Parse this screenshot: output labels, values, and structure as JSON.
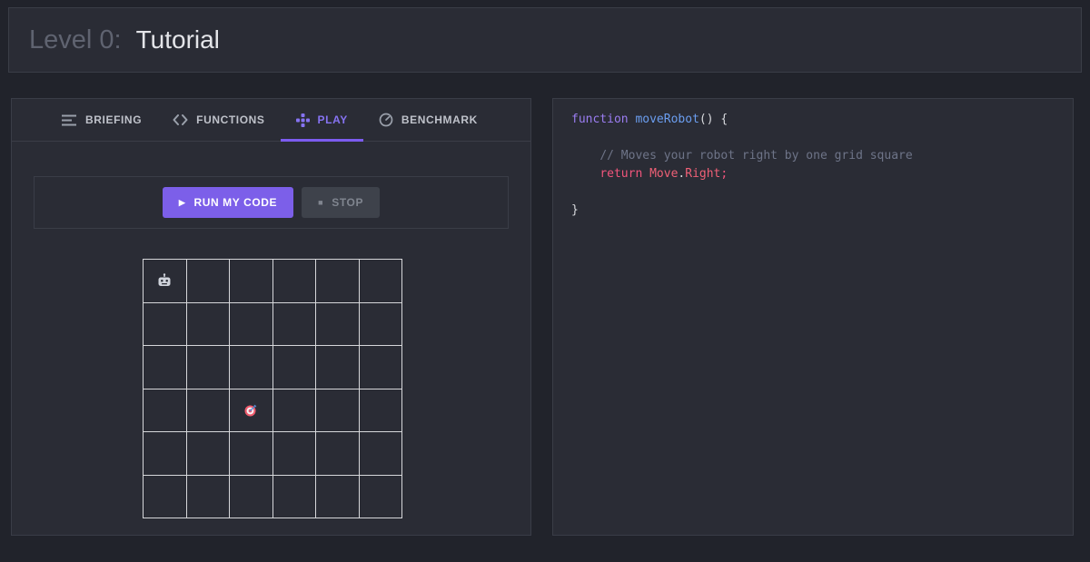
{
  "header": {
    "level_label": "Level 0:",
    "level_title": "Tutorial"
  },
  "tabs": [
    {
      "label": "BRIEFING",
      "icon": "briefing-icon",
      "active": false
    },
    {
      "label": "FUNCTIONS",
      "icon": "functions-icon",
      "active": false
    },
    {
      "label": "PLAY",
      "icon": "play-tab-icon",
      "active": true
    },
    {
      "label": "BENCHMARK",
      "icon": "benchmark-icon",
      "active": false
    }
  ],
  "controls": {
    "run_label": "RUN MY CODE",
    "stop_label": "STOP",
    "run_icon": "play-icon",
    "stop_icon": "stop-icon"
  },
  "grid": {
    "rows": 6,
    "cols": 6,
    "robot": {
      "row": 0,
      "col": 0,
      "icon": "robot-icon"
    },
    "target": {
      "row": 3,
      "col": 2,
      "icon": "target-icon"
    }
  },
  "editor": {
    "lines": [
      {
        "tokens": [
          {
            "text": "function",
            "type": "keyword"
          },
          {
            "text": " ",
            "type": "plain"
          },
          {
            "text": "moveRobot",
            "type": "function"
          },
          {
            "text": "() {",
            "type": "plain"
          }
        ]
      },
      {
        "tokens": []
      },
      {
        "tokens": [
          {
            "text": "    ",
            "type": "plain"
          },
          {
            "text": "// Moves your robot right by one grid square",
            "type": "comment"
          }
        ]
      },
      {
        "tokens": [
          {
            "text": "    ",
            "type": "plain"
          },
          {
            "text": "return",
            "type": "keyword2"
          },
          {
            "text": " ",
            "type": "plain"
          },
          {
            "text": "Move",
            "type": "variable"
          },
          {
            "text": ".",
            "type": "plain"
          },
          {
            "text": "Right",
            "type": "variable"
          },
          {
            "text": ";",
            "type": "keyword2"
          }
        ]
      },
      {
        "tokens": []
      },
      {
        "tokens": [
          {
            "text": "}",
            "type": "plain"
          }
        ]
      }
    ]
  },
  "colors": {
    "accent_purple": "#7c5cf0",
    "run_button": "#7c5fe9",
    "panel_background": "#2a2c35",
    "panel_border": "#3a3d47",
    "grid_line": "#d6d7da",
    "target_red": "#ef5b6d"
  }
}
